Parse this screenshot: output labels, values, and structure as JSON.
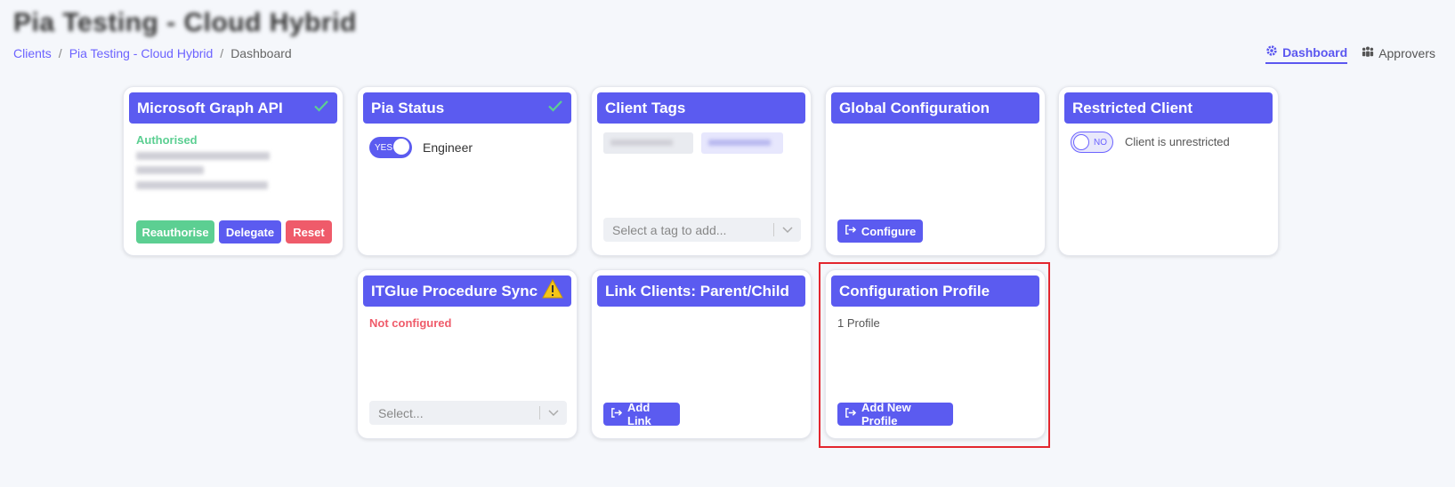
{
  "page": {
    "title": "Pia Testing - Cloud Hybrid",
    "breadcrumb": [
      "Clients",
      "Pia Testing - Cloud Hybrid",
      "Dashboard"
    ],
    "tabs": [
      {
        "label": "Dashboard",
        "icon": "gear-icon",
        "active": true
      },
      {
        "label": "Approvers",
        "icon": "users-icon",
        "active": false
      }
    ]
  },
  "cards": {
    "graph": {
      "title": "Microsoft Graph API",
      "status": "Authorised",
      "buttons": {
        "reauthorise": "Reauthorise",
        "delegate": "Delegate",
        "reset": "Reset"
      }
    },
    "pia_status": {
      "title": "Pia Status",
      "toggle": "YES",
      "label": "Engineer"
    },
    "client_tags": {
      "title": "Client Tags",
      "select_placeholder": "Select a tag to add..."
    },
    "global_config": {
      "title": "Global Configuration",
      "button": "Configure"
    },
    "restricted": {
      "title": "Restricted Client",
      "toggle": "NO",
      "label": "Client is unrestricted"
    },
    "itglue": {
      "title": "ITGlue Procedure Sync",
      "status": "Not configured",
      "select_placeholder": "Select..."
    },
    "link_clients": {
      "title": "Link Clients: Parent/Child",
      "button": "Add Link"
    },
    "config_profile": {
      "title": "Configuration Profile",
      "count": "1 Profile",
      "button": "Add New Profile"
    }
  },
  "colors": {
    "accent": "#5b5bf0",
    "success": "#5ccf92",
    "danger": "#ef5b6a",
    "warning": "#f5c518",
    "highlight": "#e3262e"
  }
}
